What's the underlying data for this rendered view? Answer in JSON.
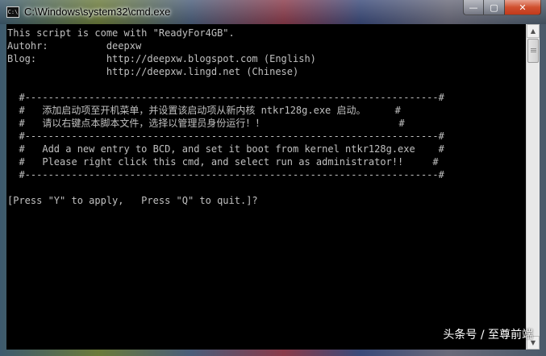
{
  "window": {
    "title": "C:\\Windows\\system32\\cmd.exe",
    "icon_label": "C:\\",
    "minimize_glyph": "—",
    "maximize_glyph": "▢",
    "close_glyph": "✕"
  },
  "console": {
    "lines": [
      "This script is come with \"ReadyFor4GB\".",
      "Autohr:          deepxw",
      "Blog:            http://deepxw.blogspot.com (English)",
      "                 http://deepxw.lingd.net (Chinese)",
      "",
      "  #-----------------------------------------------------------------------#",
      "  #   添加启动项至开机菜单，并设置该启动项从新内核 ntkr128g.exe 启动。     #",
      "  #   请以右键点本脚本文件，选择以管理员身份运行！！                       #",
      "  #-----------------------------------------------------------------------#",
      "  #   Add a new entry to BCD, and set it boot from kernel ntkr128g.exe    #",
      "  #   Please right click this cmd, and select run as administrator!!     #",
      "  #-----------------------------------------------------------------------#",
      "",
      "[Press \"Y\" to apply,   Press \"Q\" to quit.]?"
    ]
  },
  "scrollbar": {
    "up_arrow": "▲",
    "down_arrow": "▼"
  },
  "watermark": "头条号 / 至尊前端"
}
